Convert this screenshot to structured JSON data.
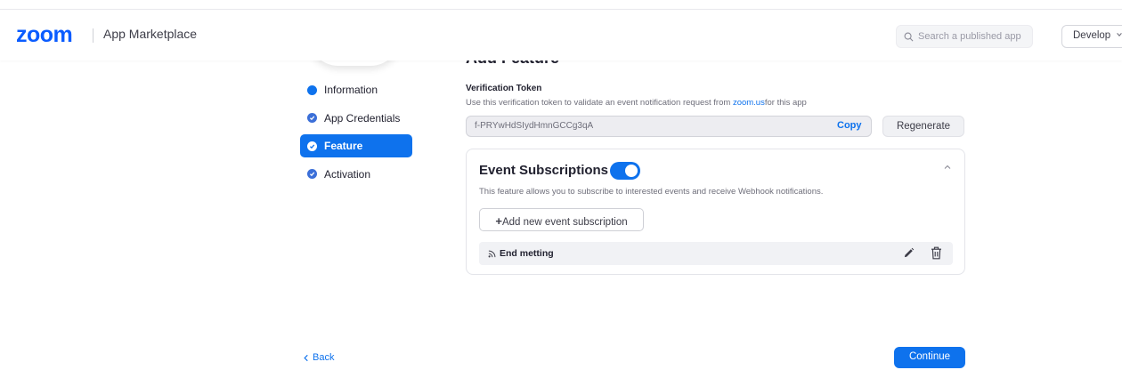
{
  "header": {
    "logo": "zoom",
    "app_name": "App Marketplace",
    "search_placeholder": "Search a published app",
    "develop_label": "Develop"
  },
  "page": {
    "heading": "Add Feature"
  },
  "nav": {
    "items": [
      {
        "label": "Information",
        "state": "current-dot"
      },
      {
        "label": "App Credentials",
        "state": "completed"
      },
      {
        "label": "Feature",
        "state": "active"
      },
      {
        "label": "Activation",
        "state": "completed"
      }
    ]
  },
  "verification": {
    "title": "Verification Token",
    "description_prefix": "Use this verification token to validate an event notification request from ",
    "description_link": "zoom.us",
    "description_suffix": "for this app",
    "token_value": "f-PRYwHdSIydHmnGCCg3qA",
    "copy_label": "Copy",
    "regenerate_label": "Regenerate"
  },
  "event_subscriptions": {
    "title": "Event Subscriptions",
    "enabled": true,
    "description": "This feature allows you to subscribe to interested events and receive Webhook notifications.",
    "add_button_label": "Add new event subscription",
    "items": [
      {
        "name": "End metting"
      }
    ]
  },
  "footer": {
    "back_label": "Back",
    "continue_label": "Continue"
  },
  "colors": {
    "accent": "#0e72ed",
    "logo": "#0b5cff"
  },
  "icons": [
    "search-icon",
    "chevron-down-icon",
    "check-icon",
    "chevron-up-icon",
    "plus-icon",
    "rss-icon",
    "edit-icon",
    "trash-icon",
    "chevron-left-icon"
  ]
}
